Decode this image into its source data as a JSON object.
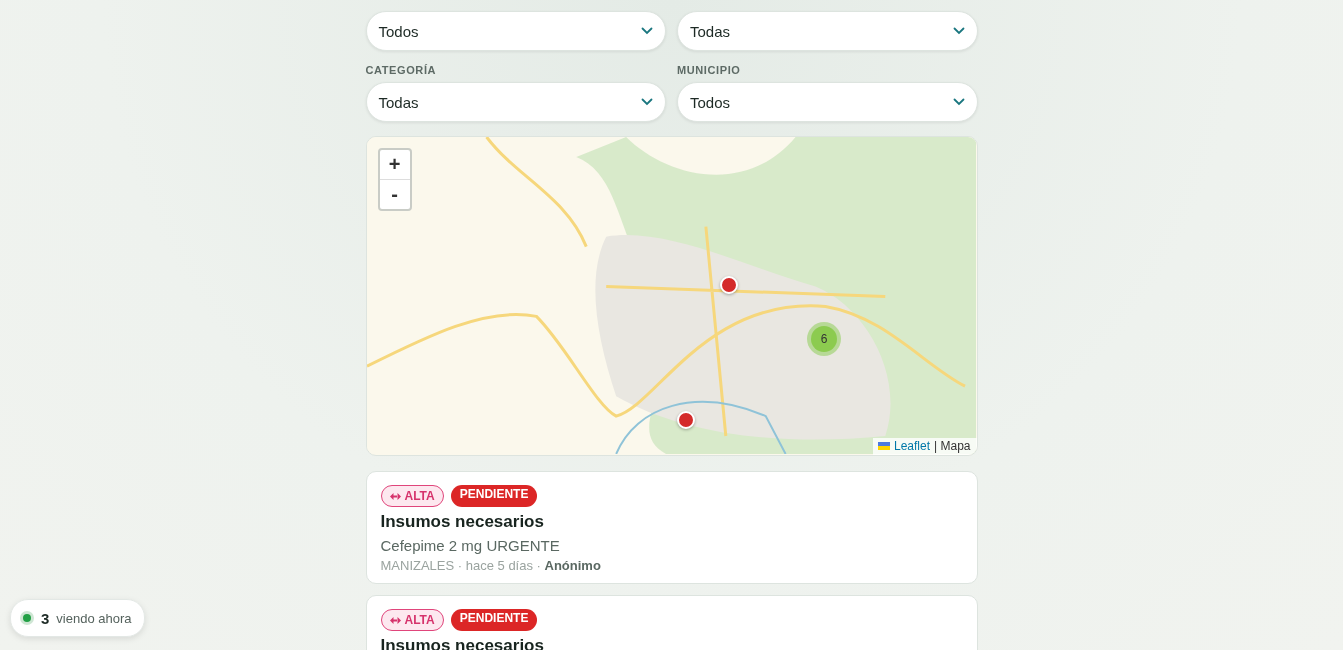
{
  "filters": [
    {
      "value": "Todos"
    },
    {
      "value": "Todas"
    },
    {
      "label": "CATEGORÍA",
      "value": "Todas"
    },
    {
      "label": "MUNICIPIO",
      "value": "Todos"
    }
  ],
  "map": {
    "zoom_buttons": [
      "+",
      "-"
    ],
    "markers": [
      {
        "kind": "pin"
      },
      {
        "kind": "cluster",
        "count": "6"
      },
      {
        "kind": "pin"
      }
    ],
    "attribution": {
      "link": "Leaflet",
      "text": "| Mapa"
    }
  },
  "reports": [
    {
      "priority": "ALTA",
      "status": "PENDIENTE",
      "title": "Insumos necesarios",
      "description": "Cefepime 2 mg URGENTE",
      "meta": "MANIZALES · hace 5 días · **Anónimo**"
    },
    {
      "priority": "ALTA",
      "status": "PENDIENTE",
      "title": "Insumos necesarios"
    }
  ],
  "viewers": {
    "count": "3",
    "label": "viendo ahora"
  }
}
